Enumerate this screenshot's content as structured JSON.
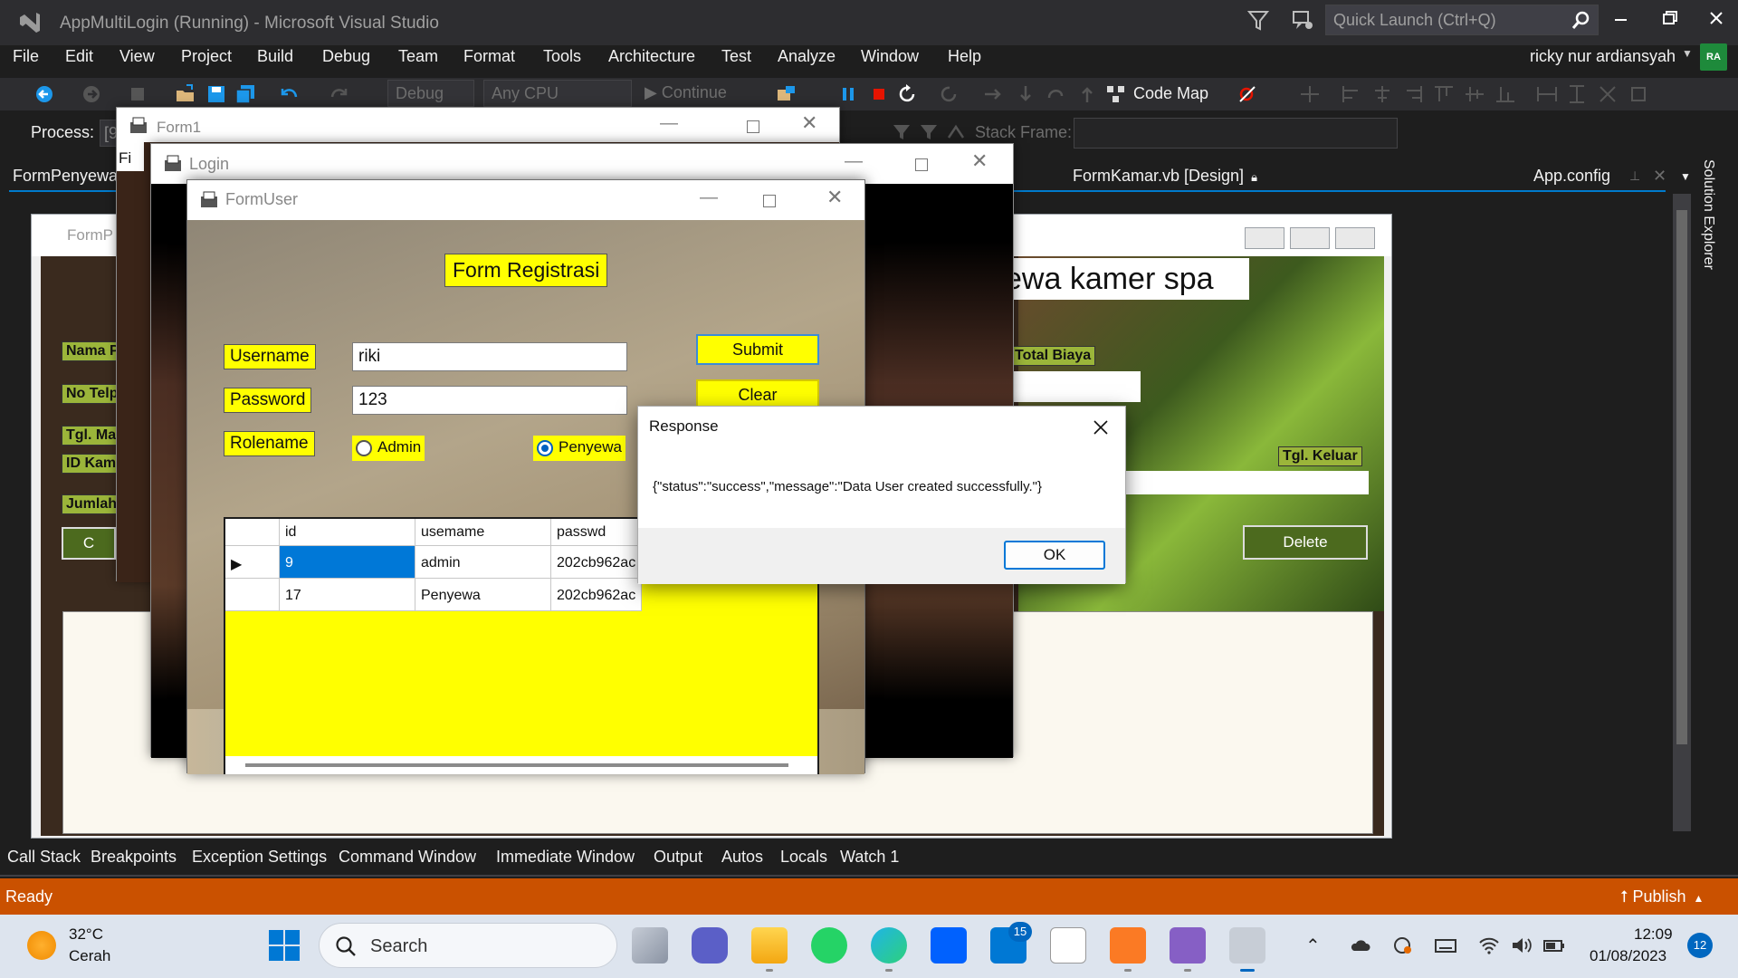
{
  "window": {
    "title": "AppMultiLogin (Running) - Microsoft Visual Studio"
  },
  "quick_launch": {
    "placeholder": "Quick Launch (Ctrl+Q)"
  },
  "menu": [
    "File",
    "Edit",
    "View",
    "Project",
    "Build",
    "Debug",
    "Team",
    "Format",
    "Tools",
    "Architecture",
    "Test",
    "Analyze",
    "Window",
    "Help"
  ],
  "user": {
    "name": "ricky nur ardiansyah",
    "initials": "RA"
  },
  "toolbar": {
    "config": "Debug",
    "platform": "Any CPU",
    "continue": "Continue",
    "code_map": "Code Map"
  },
  "debug_location": {
    "process_label": "Process:",
    "process_value": "[9",
    "stack_frame_label": "Stack Frame:"
  },
  "doc_tabs": {
    "left": "FormPenyewa.",
    "middle": "FormKamar.vb [Design]",
    "right": "App.config"
  },
  "solution_explorer": "Solution Explorer",
  "designer": {
    "title": "FormP",
    "banner": "ewa kamer spa",
    "labels": {
      "nama": "Nama P",
      "notelp": "No Telp",
      "tglmasuk": "Tgl. Ma",
      "idkamar": "ID Kam",
      "jumlah": "Jumlah",
      "totalbiaya": "Total Biaya",
      "tglkeluar": "Tgl. Keluar"
    },
    "buttons": {
      "left": "C",
      "delete": "Delete"
    }
  },
  "form1": {
    "title": "Form1",
    "menu_stub": "Fi"
  },
  "login": {
    "title": "Login"
  },
  "formuser": {
    "title": "FormUser",
    "heading": "Form Registrasi",
    "username_label": "Username",
    "username_value": "riki",
    "password_label": "Password",
    "password_value": "123",
    "rolename_label": "Rolename",
    "role_admin": "Admin",
    "role_penyewa": "Penyewa",
    "submit": "Submit",
    "clear": "Clear",
    "grid": {
      "columns": [
        "id",
        "usemame",
        "passwd"
      ],
      "rows": [
        [
          "9",
          "admin",
          "202cb962ac"
        ],
        [
          "17",
          "Penyewa",
          "202cb962ac"
        ]
      ]
    }
  },
  "message_box": {
    "title": "Response",
    "text": "{\"status\":\"success\",\"message\":\"Data User created successfully.\"}",
    "ok": "OK"
  },
  "bottom_tabs": [
    "Call Stack",
    "Breakpoints",
    "Exception Settings",
    "Command Window",
    "Immediate Window",
    "Output",
    "Autos",
    "Locals",
    "Watch 1"
  ],
  "status": {
    "ready": "Ready",
    "publish": "Publish"
  },
  "taskbar": {
    "weather_temp": "32°C",
    "weather_desc": "Cerah",
    "search": "Search",
    "mail_badge": "15",
    "time": "12:09",
    "date": "01/08/2023",
    "notifications": "12"
  },
  "colors": {
    "accent": "#007acc",
    "status_bar": "#ca5100",
    "form_yellow": "#ffff00",
    "selection": "#0078d7"
  }
}
